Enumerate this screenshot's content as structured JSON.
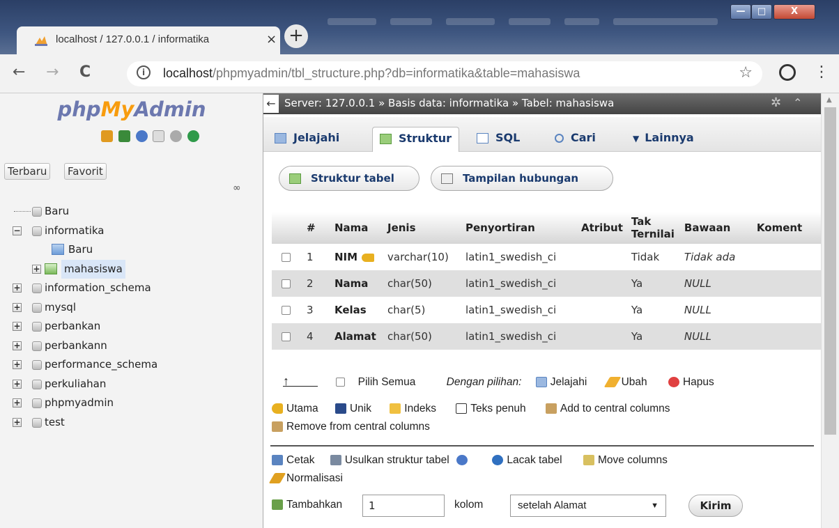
{
  "browser": {
    "tab_title": "localhost / 127.0.0.1 / informatika",
    "tab_close": "×",
    "new_tab": "+",
    "url_host": "localhost",
    "url_path": "/phpmyadmin/tbl_structure.php?db=informatika&table=mahasiswa",
    "back": "←",
    "forward": "→",
    "reload": "C",
    "star": "☆",
    "menu": "⋮",
    "info": "i"
  },
  "window_controls": {
    "minimize": "—",
    "maximize": "□",
    "close": "X"
  },
  "sidebar": {
    "logo_php": "php",
    "logo_my": "My",
    "logo_admin": "Admin",
    "recent_label": "Terbaru",
    "favorites_label": "Favorit",
    "tree": [
      {
        "label": "Baru"
      },
      {
        "label": "informatika"
      },
      {
        "label": "Baru"
      },
      {
        "label": "mahasiswa"
      },
      {
        "label": "information_schema"
      },
      {
        "label": "mysql"
      },
      {
        "label": "perbankan"
      },
      {
        "label": "perbankann"
      },
      {
        "label": "performance_schema"
      },
      {
        "label": "perkuliahan"
      },
      {
        "label": "phpmyadmin"
      },
      {
        "label": "test"
      }
    ]
  },
  "breadcrumb": {
    "back": "←",
    "text": "Server: 127.0.0.1 » Basis data: informatika » Tabel: mahasiswa"
  },
  "tabs": [
    {
      "label": "Jelajahi"
    },
    {
      "label": "Struktur"
    },
    {
      "label": "SQL"
    },
    {
      "label": "Cari"
    },
    {
      "label": "Lainnya"
    }
  ],
  "sub_buttons": {
    "structure": "Struktur tabel",
    "relation": "Tampilan hubungan"
  },
  "structure_table": {
    "headers": [
      "#",
      "Nama",
      "Jenis",
      "Penyortiran",
      "Atribut",
      "Tak Ternilai",
      "Bawaan",
      "Koment"
    ],
    "rows": [
      {
        "num": "1",
        "name": "NIM",
        "type": "varchar(10)",
        "collation": "latin1_swedish_ci",
        "attr": "",
        "null": "Tidak",
        "default": "Tidak ada"
      },
      {
        "num": "2",
        "name": "Nama",
        "type": "char(50)",
        "collation": "latin1_swedish_ci",
        "attr": "",
        "null": "Ya",
        "default": "NULL"
      },
      {
        "num": "3",
        "name": "Kelas",
        "type": "char(5)",
        "collation": "latin1_swedish_ci",
        "attr": "",
        "null": "Ya",
        "default": "NULL"
      },
      {
        "num": "4",
        "name": "Alamat",
        "type": "char(50)",
        "collation": "latin1_swedish_ci",
        "attr": "",
        "null": "Ya",
        "default": "NULL"
      }
    ]
  },
  "bulk": {
    "check_all": "Pilih Semua",
    "with_selected": "Dengan pilihan:",
    "browse": "Jelajahi",
    "change": "Ubah",
    "drop": "Hapus",
    "primary": "Utama",
    "unique": "Unik",
    "index": "Indeks",
    "fulltext": "Teks penuh",
    "add_central": "Add to central columns",
    "remove_central": "Remove from central columns"
  },
  "actions": {
    "print": "Cetak",
    "propose": "Usulkan struktur tabel",
    "track": "Lacak tabel",
    "move": "Move columns",
    "normalize": "Normalisasi"
  },
  "add_columns": {
    "label": "Tambahkan",
    "count": "1",
    "unit": "kolom",
    "position": "setelah Alamat",
    "submit": "Kirim"
  },
  "colors": {
    "logo_blue": "#6c78af",
    "logo_orange": "#f89c0e",
    "link": "#235a9c",
    "tab_text": "#1a3a6e"
  }
}
